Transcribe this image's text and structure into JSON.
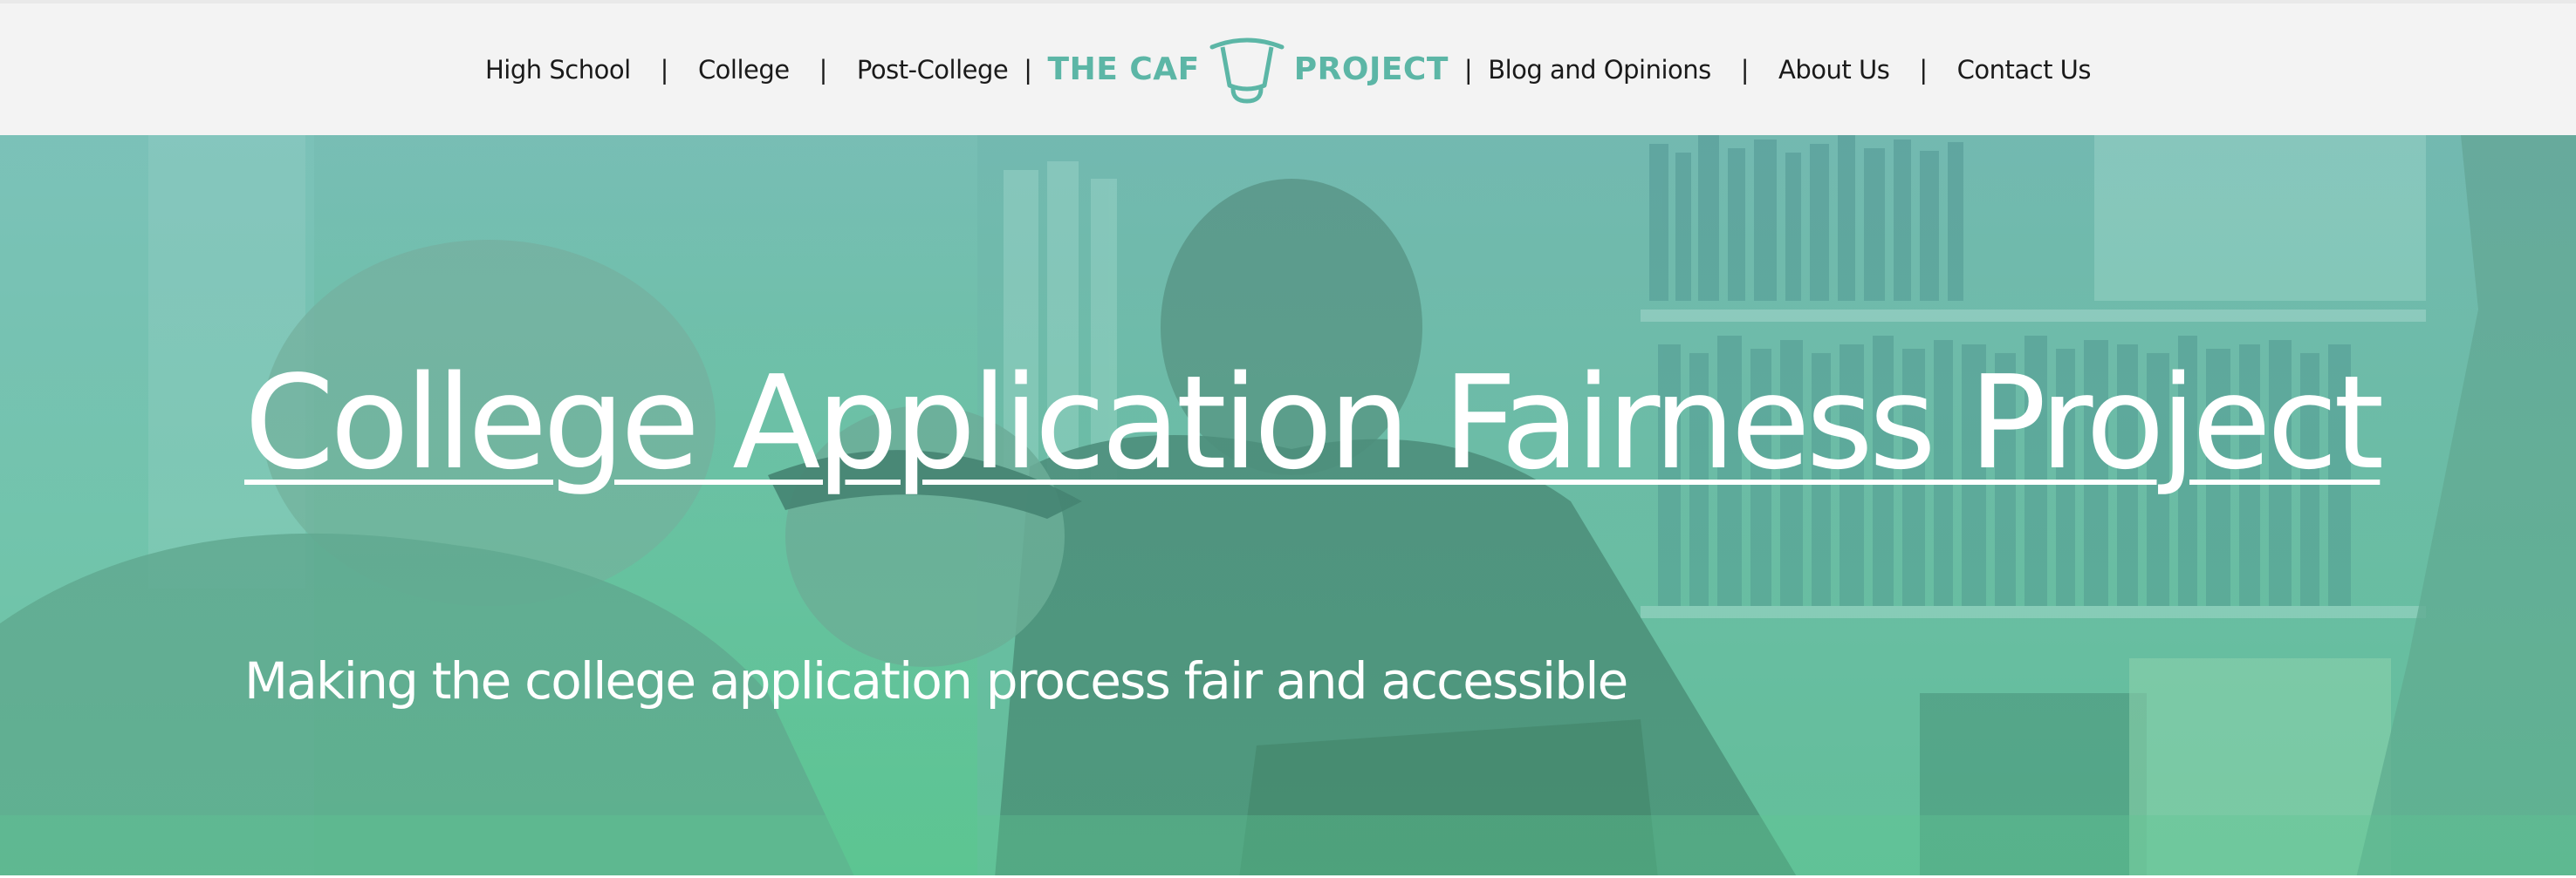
{
  "nav": {
    "items_left": [
      "High School",
      "College",
      "Post-College"
    ],
    "items_right": [
      "Blog and Opinions",
      "About Us",
      "Contact Us"
    ],
    "separator": "|",
    "logo": {
      "left_text": "THE CAF",
      "right_text": "PROJECT",
      "icon": "cup-icon",
      "color": "#5cb6a6"
    }
  },
  "hero": {
    "title": "College Application Fairness Project",
    "subtitle": "Making the college application process fair and accessible",
    "overlay_color": "#6cc4a8"
  }
}
